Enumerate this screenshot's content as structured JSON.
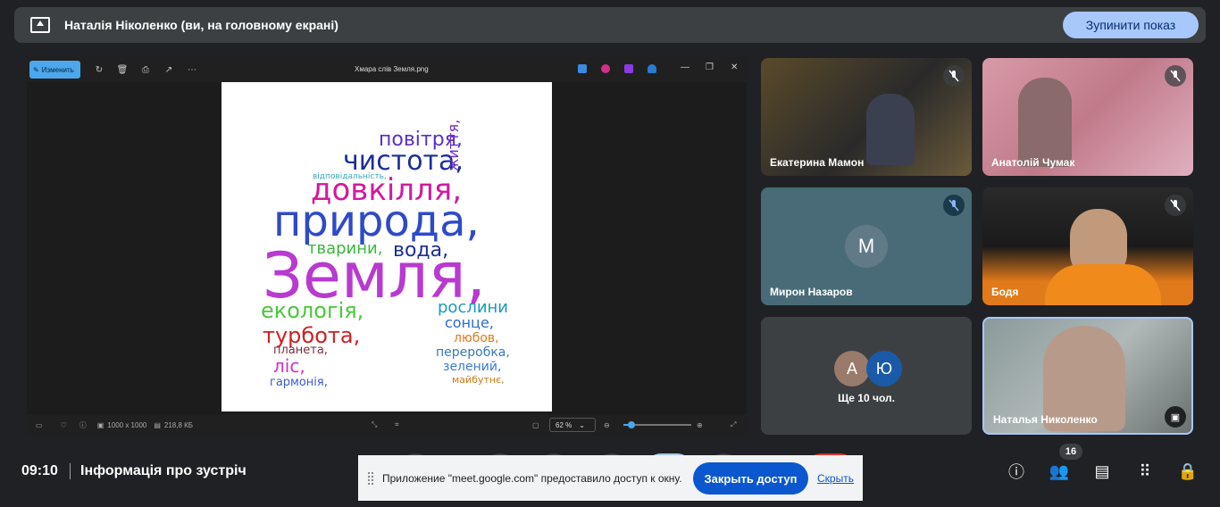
{
  "present_bar": {
    "title": "Наталія Ніколенко (ви, на головному екрані)",
    "stop_label": "Зупинити показ"
  },
  "viewer": {
    "edit_label": "Изменить",
    "file_name": "Хмара слів Земля.png",
    "dimensions": "1000 x 1000",
    "file_size": "218,8 КБ",
    "zoom": "62 %",
    "zoom_fraction": 0.62,
    "word_cloud": [
      {
        "t": "Земля,",
        "c": "#b83ad0"
      },
      {
        "t": "природа,",
        "c": "#2f4ac8"
      },
      {
        "t": "довкілля,",
        "c": "#d11aa0"
      },
      {
        "t": "чистота,",
        "c": "#1a2f9a"
      },
      {
        "t": "повітря,",
        "c": "#5a2fc8"
      },
      {
        "t": "екологія,",
        "c": "#4ac83a"
      },
      {
        "t": "турбота,",
        "c": "#d02020"
      },
      {
        "t": "тварини,",
        "c": "#3ab83a"
      },
      {
        "t": "вода,",
        "c": "#1a2f9a"
      },
      {
        "t": "рослини",
        "c": "#1a9ab8"
      },
      {
        "t": "сонце,",
        "c": "#2a6ad0"
      },
      {
        "t": "любов,",
        "c": "#e07a1a"
      },
      {
        "t": "переробка,",
        "c": "#3a7ab8"
      },
      {
        "t": "зелений,",
        "c": "#3a7ad0"
      },
      {
        "t": "майбутнє,",
        "c": "#d07a1a"
      },
      {
        "t": "ліс,",
        "c": "#d030d0"
      },
      {
        "t": "гармонія,",
        "c": "#3a5ad0"
      },
      {
        "t": "планета,",
        "c": "#7a2f3a"
      },
      {
        "t": "життя,",
        "c": "#6a2fc8"
      },
      {
        "t": "відповідальність,",
        "c": "#3aa8b8"
      }
    ]
  },
  "participants": [
    {
      "name": "Екатерина Мамон",
      "muted": true
    },
    {
      "name": "Анатолій Чумак",
      "muted": true
    },
    {
      "name": "Мирон Назаров",
      "muted": true,
      "initial": "M"
    },
    {
      "name": "Бодя",
      "muted": true
    },
    {
      "more_initials": [
        "А",
        "Ю"
      ],
      "more_label": "Ще 10 чол."
    },
    {
      "name": "Наталья Николенко"
    }
  ],
  "bottom": {
    "time": "09:10",
    "meeting_info": "Інформація про зустріч",
    "people_count": "16"
  },
  "notification": {
    "text": "Приложение \"meet.google.com\" предоставило доступ к окну.",
    "close_label": "Закрыть доступ",
    "hide_label": "Скрыть"
  }
}
